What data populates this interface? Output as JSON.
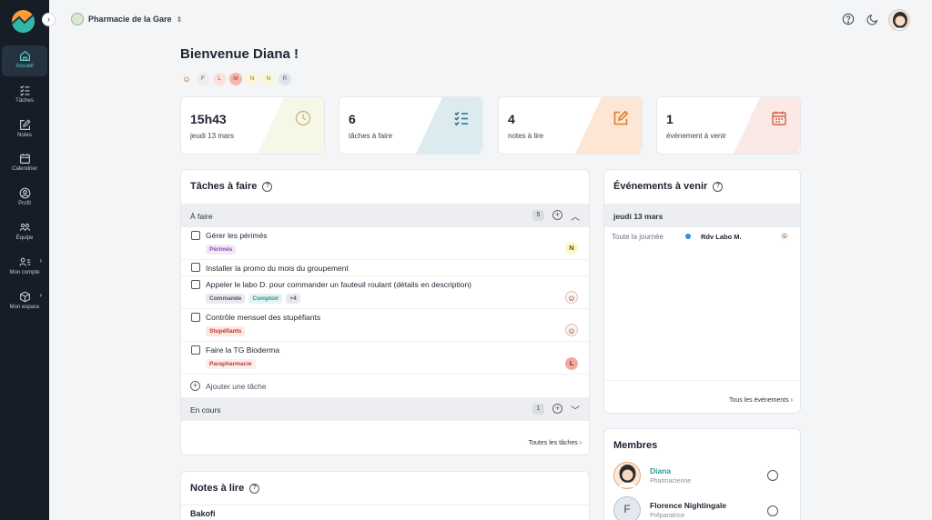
{
  "sidebar": {
    "items": [
      {
        "label": "Accueil",
        "icon": "home-icon"
      },
      {
        "label": "Tâches",
        "icon": "checklist-icon"
      },
      {
        "label": "Notes",
        "icon": "edit-icon"
      },
      {
        "label": "Calendrier",
        "icon": "calendar-icon"
      },
      {
        "label": "Profil",
        "icon": "user-circle-icon"
      },
      {
        "label": "Équipe",
        "icon": "team-icon"
      },
      {
        "label": "Mon compte",
        "icon": "account-icon"
      },
      {
        "label": "Mon espace",
        "icon": "cube-icon"
      }
    ]
  },
  "header": {
    "pharmacy": "Pharmacie de la Gare"
  },
  "welcome": "Bienvenue Diana !",
  "team": [
    "F",
    "L",
    "M",
    "N",
    "N",
    "R"
  ],
  "stats": [
    {
      "value": "15h43",
      "label": "jeudi 13 mars",
      "icon": "clock-icon",
      "color": "#f1f3d9"
    },
    {
      "value": "6",
      "label": "tâches à faire",
      "icon": "checklist-icon",
      "color": "#dcebef"
    },
    {
      "value": "4",
      "label": "notes à lire",
      "icon": "edit-icon",
      "color": "#fde6d3"
    },
    {
      "value": "1",
      "label": "événement à venir",
      "icon": "calendar-icon",
      "color": "#fbe4df"
    }
  ],
  "tasks": {
    "title": "Tâches à faire",
    "todo_label": "À faire",
    "todo_count": "5",
    "items": [
      {
        "text": "Gérer les périmés",
        "tags": [
          {
            "label": "Périmés",
            "color": "#8a4bb0",
            "bg": "#f3e9f8"
          }
        ],
        "avatar": "N"
      },
      {
        "text": "Installer la promo du mois du groupement",
        "tags": [],
        "avatar": ""
      },
      {
        "text": "Appeler le labo D. pour commander un fauteuil roulant (détails en description)",
        "tags": [
          {
            "label": "Commande",
            "color": "#4d5562",
            "bg": "#e8eaee"
          },
          {
            "label": "Comptoir",
            "color": "#2c8c8c",
            "bg": "#e3f4f3"
          },
          {
            "label": "+4",
            "color": "#4d5562",
            "bg": "#e8eaee"
          }
        ],
        "avatar": "face"
      },
      {
        "text": "Contrôle mensuel des stupéfiants",
        "tags": [
          {
            "label": "Stupéfiants",
            "color": "#c0392b",
            "bg": "#fbe7e4"
          }
        ],
        "avatar": "face"
      },
      {
        "text": "Faire la TG Bioderma",
        "tags": [
          {
            "label": "Parapharmacie",
            "color": "#c0392b",
            "bg": "#fbeeee"
          }
        ],
        "avatar": "L"
      }
    ],
    "add_label": "Ajouter une tâche",
    "progress_label": "En cours",
    "progress_count": "1",
    "all_link": "Toutes les tâches"
  },
  "notes": {
    "title": "Notes à lire",
    "first": "Bakofi"
  },
  "events": {
    "title": "Événements à venir",
    "date": "jeudi 13 mars",
    "items": [
      {
        "when": "Toute la journée",
        "name": "Rdv Labo M.",
        "color": "#3a8be0"
      }
    ],
    "all_link": "Tous les événements"
  },
  "members": {
    "title": "Membres",
    "items": [
      {
        "name": "Diana",
        "role": "Pharmacienne",
        "initial": "",
        "highlight": true
      },
      {
        "name": "Florence Nightingale",
        "role": "Préparatrice",
        "initial": "F",
        "highlight": false
      }
    ]
  }
}
